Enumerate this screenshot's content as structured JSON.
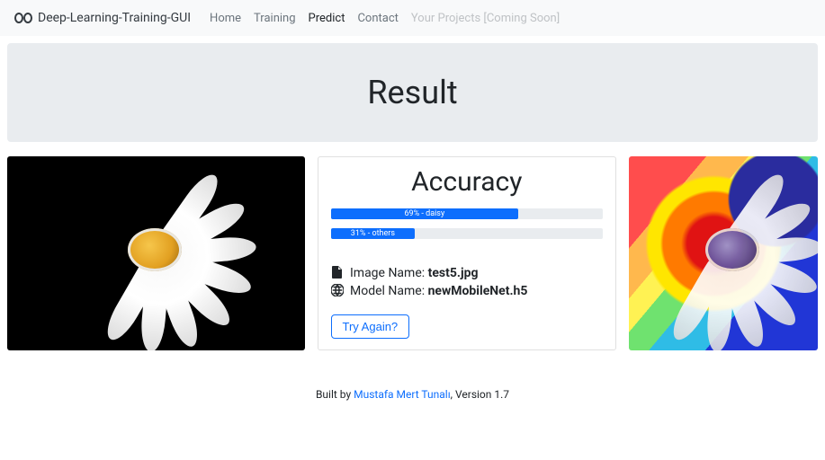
{
  "brand": "Deep-Learning-Training-GUI",
  "nav": {
    "items": [
      {
        "label": "Home"
      },
      {
        "label": "Training"
      },
      {
        "label": "Predict"
      },
      {
        "label": "Contact"
      },
      {
        "label": "Your Projects [Coming Soon]"
      }
    ]
  },
  "jumbo": {
    "title": "Result"
  },
  "result": {
    "heading": "Accuracy",
    "predictions": [
      {
        "label": "69% - daisy",
        "percent": 69
      },
      {
        "label": "31% - others",
        "percent": 31
      }
    ],
    "image_label": "Image Name:",
    "image_value": "test5.jpg",
    "model_label": "Model Name:",
    "model_value": "newMobileNet.h5",
    "try_again_label": "Try Again?"
  },
  "footer": {
    "prefix": "Built by ",
    "author": "Mustafa Mert Tunalı",
    "suffix": ", Version 1.7"
  },
  "chart_data": {
    "type": "bar",
    "title": "Accuracy",
    "categories": [
      "daisy",
      "others"
    ],
    "values": [
      69,
      31
    ],
    "xlabel": "",
    "ylabel": "",
    "ylim": [
      0,
      100
    ]
  }
}
